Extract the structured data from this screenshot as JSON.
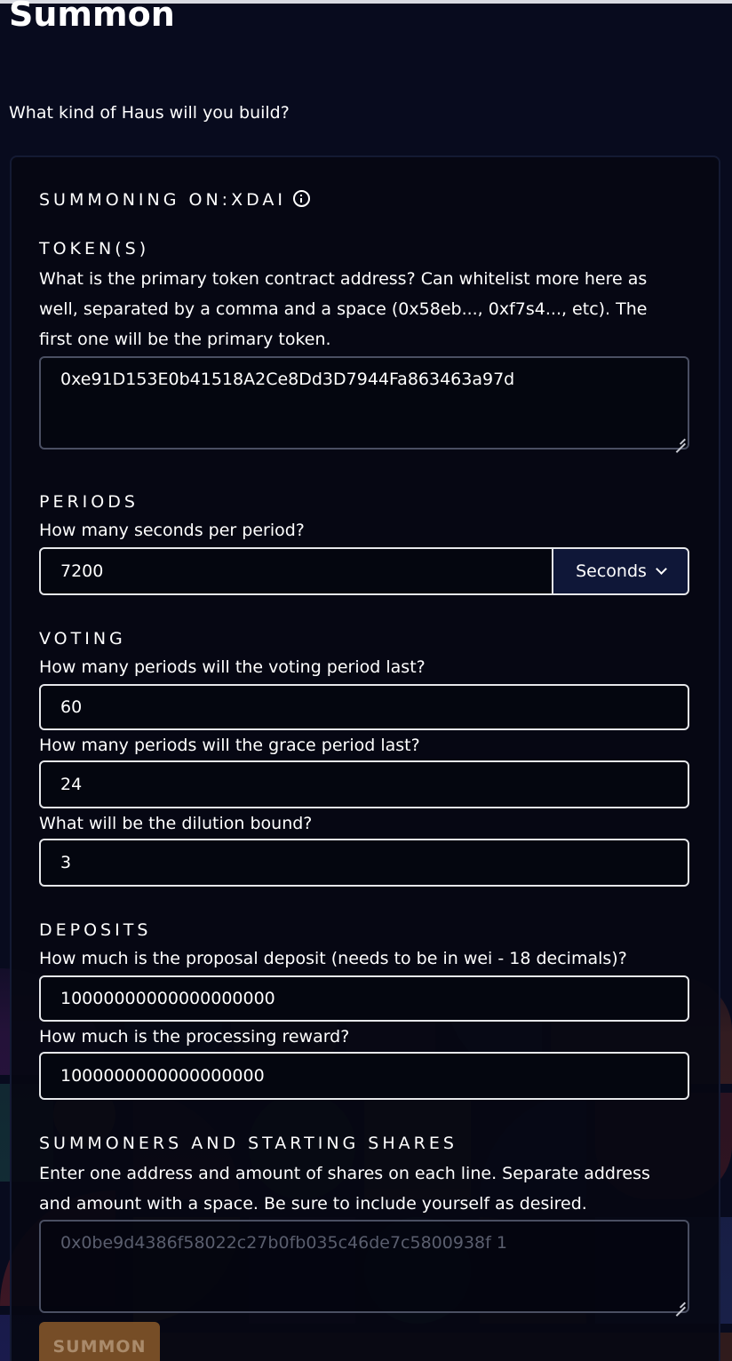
{
  "page": {
    "title": "Summon",
    "subtitle": "What kind of Haus will you build?"
  },
  "network": {
    "heading": "SUMMONING ON:XDAI",
    "info_icon": "info-circle-icon"
  },
  "token": {
    "heading": "TOKEN(S)",
    "description": "What is the primary token contract address? Can whitelist more here as well, separated by a comma and a space (0x58eb..., 0xf7s4..., etc). The first one will be the primary token.",
    "value": "0xe91D153E0b41518A2Ce8Dd3D7944Fa863463a97d"
  },
  "periods": {
    "heading": "PERIODS",
    "question": "How many seconds per period?",
    "value": "7200",
    "unit_selected": "Seconds",
    "unit_icon": "chevron-down-icon"
  },
  "voting": {
    "heading": "VOTING",
    "voting_question": "How many periods will the voting period last?",
    "voting_value": "60",
    "grace_question": "How many periods will the grace period last?",
    "grace_value": "24",
    "dilution_question": "What will be the dilution bound?",
    "dilution_value": "3"
  },
  "deposits": {
    "heading": "DEPOSITS",
    "proposal_question": "How much is the proposal deposit (needs to be in wei - 18 decimals)?",
    "proposal_value": "10000000000000000000",
    "reward_question": "How much is the processing reward?",
    "reward_value": "1000000000000000000"
  },
  "summoners": {
    "heading": "SUMMONERS AND STARTING SHARES",
    "description": "Enter one address and amount of shares on each line. Separate address and amount with a space. Be sure to include yourself as desired.",
    "placeholder": "0x0be9d4386f58022c27b0fb035c46de7c5800938f 1"
  },
  "actions": {
    "summon_label": "SUMMON"
  },
  "colors": {
    "background": "#080b1e",
    "card_background": "#06081200",
    "select_background": "#0f1738",
    "button_background": "#8a5a2a",
    "field_border": "#e6e7ea"
  }
}
